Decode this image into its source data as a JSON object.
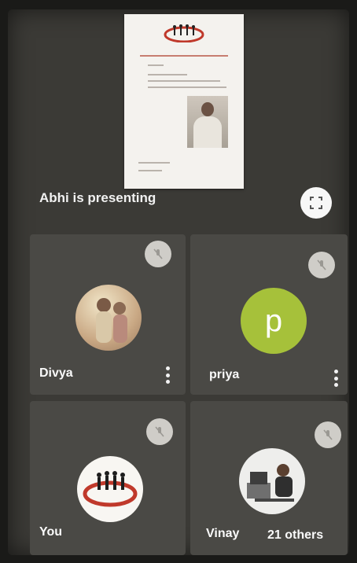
{
  "presentation": {
    "presenter_label": "Abhi is presenting"
  },
  "participants": [
    {
      "name": "Divya",
      "avatar": "photo",
      "mic": "muted"
    },
    {
      "name": "priya",
      "avatar": "initial",
      "initial": "p",
      "avatar_color": "#a6c13a",
      "mic": "muted"
    },
    {
      "name": "You",
      "avatar": "logo",
      "mic": "muted"
    },
    {
      "name": "Vinay",
      "avatar": "photo",
      "mic": "muted"
    }
  ],
  "others_label": "21 others",
  "icons": {
    "fullscreen": "fullscreen-icon",
    "mic_off": "mic-off-icon",
    "more": "more-vert-icon"
  },
  "colors": {
    "background": "#3b3a36",
    "tile": "#4a4945",
    "accent_avatar": "#a6c13a"
  }
}
